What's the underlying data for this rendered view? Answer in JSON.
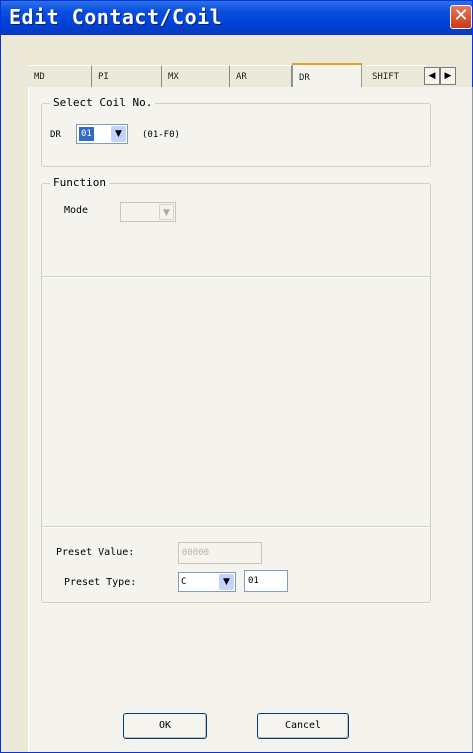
{
  "window": {
    "title": "Edit Contact/Coil",
    "close_glyph": "✕"
  },
  "tabs": {
    "items": [
      "MD",
      "PI",
      "MX",
      "AR",
      "DR",
      "SHIFT"
    ],
    "active": "DR",
    "scroll_left": "◀",
    "scroll_right": "▶"
  },
  "select_coil": {
    "legend": "Select Coil No.",
    "prefix": "DR",
    "value": "01",
    "range": "(01-F0)",
    "arrow": "▼"
  },
  "function": {
    "legend": "Function",
    "mode_label": "Mode",
    "mode_value": "",
    "arrow": "▼"
  },
  "preset": {
    "value_label": "Preset Value:",
    "value_placeholder": "00000",
    "type_label": "Preset Type:",
    "type_value": "C",
    "type_arrow": "▼",
    "type_number": "01"
  },
  "buttons": {
    "ok": "OK",
    "cancel": "Cancel"
  },
  "colors": {
    "title_bar": "#0040d8",
    "dialog_face": "#ece9d8",
    "selection": "#316ac5"
  }
}
